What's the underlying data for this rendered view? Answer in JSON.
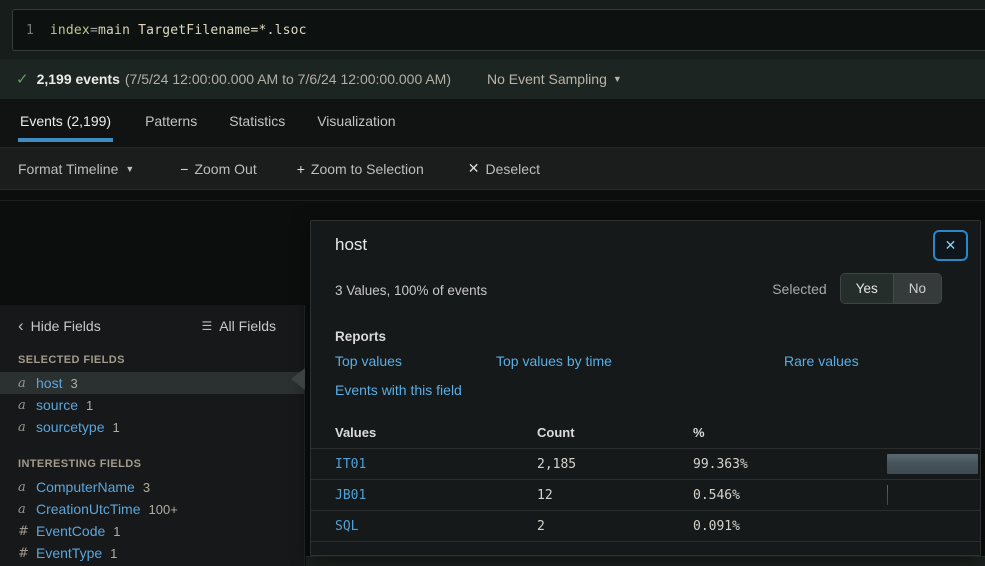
{
  "colors": {
    "link_blue": "#58aee6",
    "sidebar_field_blue": "#5ca6db",
    "mono_link_blue": "#529fd6",
    "active_tab_underline": "#3e8cc2",
    "check_green": "#5aa55e",
    "close_button_border": "#2c86c8",
    "bar_fill": "#46535b"
  },
  "search_bar": {
    "line_number": "1",
    "tokens": [
      {
        "text": "index",
        "type": "keyword"
      },
      {
        "text": "=",
        "type": "op"
      },
      {
        "text": "main",
        "type": "value"
      },
      {
        "text": " TargetFilename=*.lsoc",
        "type": "plain"
      }
    ]
  },
  "status_bar": {
    "check_icon": "✓",
    "event_count": "2,199 events",
    "time_range": "(7/5/24 12:00:00.000 AM to 7/6/24 12:00:00.000 AM)",
    "sampling_label": "No Event Sampling",
    "caret": "▼"
  },
  "tabs": [
    {
      "label": "Events (2,199)",
      "active": true
    },
    {
      "label": "Patterns",
      "active": false
    },
    {
      "label": "Statistics",
      "active": false
    },
    {
      "label": "Visualization",
      "active": false
    }
  ],
  "timeline_toolbar": {
    "format_timeline_label": "Format Timeline",
    "format_caret": "▼",
    "zoom_out_glyph": "−",
    "zoom_out_label": "Zoom Out",
    "zoom_selection_glyph": "+",
    "zoom_selection_label": "Zoom to Selection",
    "deselect_glyph": "✕",
    "deselect_label": "Deselect"
  },
  "sidebar": {
    "hide_fields_chevron": "‹",
    "hide_fields_label": "Hide Fields",
    "all_fields_icon": "☰",
    "all_fields_label": "All Fields",
    "selected_fields_header": "SELECTED FIELDS",
    "selected_fields": [
      {
        "prefix": "a",
        "name": "host",
        "count": "3"
      },
      {
        "prefix": "a",
        "name": "source",
        "count": "1"
      },
      {
        "prefix": "a",
        "name": "sourcetype",
        "count": "1"
      }
    ],
    "interesting_fields_header": "INTERESTING FIELDS",
    "interesting_fields": [
      {
        "prefix": "a",
        "name": "ComputerName",
        "count": "3"
      },
      {
        "prefix": "a",
        "name": "CreationUtcTime",
        "count": "100+"
      },
      {
        "prefix": "#",
        "name": "EventCode",
        "count": "1"
      },
      {
        "prefix": "#",
        "name": "EventType",
        "count": "1"
      }
    ]
  },
  "popup": {
    "title": "host",
    "close_glyph": "✕",
    "summary": "3 Values, 100% of events",
    "selected_label": "Selected",
    "yes_label": "Yes",
    "no_label": "No",
    "reports_header": "Reports",
    "report_links": [
      "Top values",
      "Top values by time",
      "Rare values",
      "Events with this field"
    ],
    "table": {
      "headers": [
        "Values",
        "Count",
        "%"
      ],
      "rows": [
        {
          "value": "IT01",
          "count": "2,185",
          "percent": "99.363%",
          "bar_pct": 99.363
        },
        {
          "value": "JB01",
          "count": "12",
          "percent": "0.546%",
          "bar_pct": 0.546
        },
        {
          "value": "SQL",
          "count": "2",
          "percent": "0.091%",
          "bar_pct": 0.091
        }
      ]
    }
  }
}
